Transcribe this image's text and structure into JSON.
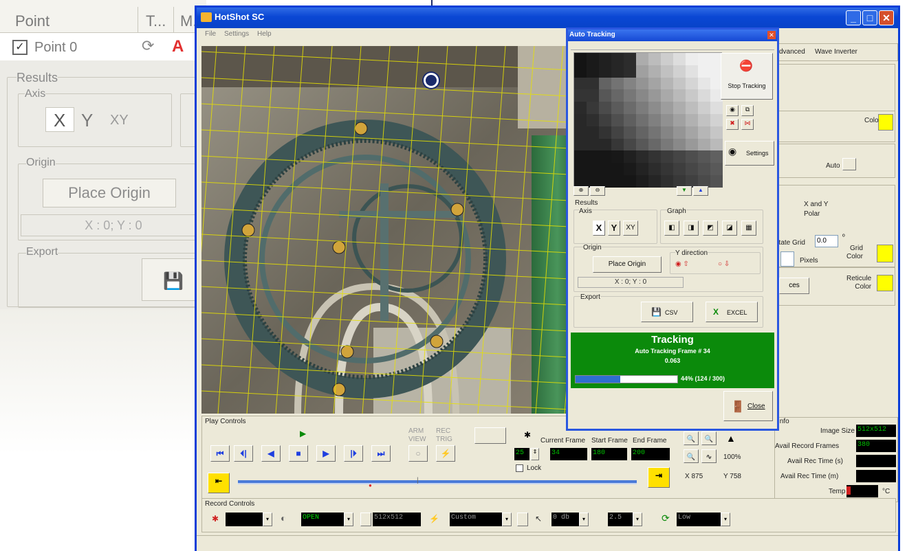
{
  "bg_panel": {
    "col_point": "Point",
    "col_t": "T...",
    "col_m": "M.",
    "row_label": "Point 0",
    "results": "Results",
    "axis": "Axis",
    "axis_x": "X",
    "axis_y": "Y",
    "axis_xy": "XY",
    "origin": "Origin",
    "place_origin": "Place Origin",
    "coords": "X : 0; Y : 0",
    "export": "Export"
  },
  "window": {
    "title": "HotShot SC",
    "menu": [
      "File",
      "Settings",
      "Help"
    ]
  },
  "right_panel": {
    "tab_advanced": "dvanced",
    "tab_wave": "Wave Inverter",
    "color_label": "Color",
    "auto_label": "Auto",
    "radio_xy": "X and Y",
    "radio_polar": "Polar",
    "rotate_grid": "otate Grid",
    "rotate_val": "0.0",
    "degree": "º",
    "pixels": "Pixels",
    "grid_color": "Grid\nColor",
    "reticule_color": "Reticule\nColor",
    "ces_btn": "ces"
  },
  "play_controls": {
    "title": "Play Controls",
    "arm_view": "ARM\nVIEW",
    "rec_trig": "REC\nTRIG",
    "current_frame_label": "Current Frame",
    "start_frame_label": "Start Frame",
    "end_frame_label": "End Frame",
    "speed": "25",
    "current_frame": "34",
    "start_frame": "180",
    "end_frame": "200",
    "lock": "Lock",
    "zoom": "100%",
    "x_coord": "X 875",
    "y_coord": "Y 758"
  },
  "info_panel": {
    "title": "Info",
    "image_size_label": "Image Size",
    "image_size": "512x512",
    "avail_frames_label": "Avail Record Frames",
    "avail_frames": "380",
    "avail_time_s_label": "Avail Rec Time (s)",
    "avail_time_m_label": "Avail Rec Time (m)",
    "temp_label": "Temp",
    "temp_unit": "°C"
  },
  "record_controls": {
    "title": "Record Controls",
    "shutter": "OPEN",
    "resolution": "512x512",
    "mode": "Custom",
    "gain": "0 db",
    "gain2": "2.5",
    "level": "Low"
  },
  "auto_tracking": {
    "title": "Auto Tracking",
    "stop_tracking": "Stop Tracking",
    "settings": "Settings",
    "results": "Results",
    "axis": "Axis",
    "axis_x": "X",
    "axis_y": "Y",
    "axis_xy": "XY",
    "graph": "Graph",
    "origin": "Origin",
    "y_direction": "Y direction",
    "place_origin": "Place Origin",
    "coords": "X : 0; Y : 0",
    "export": "Export",
    "csv": "CSV",
    "excel": "EXCEL",
    "tracking": "Tracking",
    "tracking_frame": "Auto Tracking Frame # 34",
    "tracking_value": "0.063",
    "progress_text": "44% (124 / 300)",
    "progress_fraction": 0.44,
    "close": "Close"
  },
  "colors": {
    "title_blue": "#0a47d4",
    "window_bg": "#ece9d8",
    "grid_yellow": "#e8e200",
    "track_green": "#0b8a0b",
    "lcd_green": "#00c000"
  }
}
